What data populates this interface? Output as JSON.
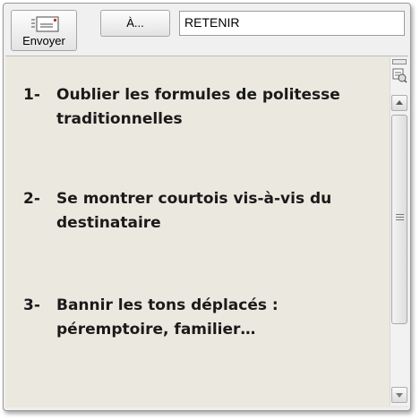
{
  "toolbar": {
    "send_label": "Envoyer",
    "send_icon": "send-envelope-icon",
    "to_label": "À...",
    "subject_value": "RETENIR"
  },
  "message": {
    "items": [
      {
        "num": "1-",
        "text": "Oublier les formules de politesse traditionnelles"
      },
      {
        "num": "2-",
        "text": "Se montrer courtois vis-à-vis du destinataire"
      },
      {
        "num": "3-",
        "text": "Bannir les tons déplacés : péremptoire, familier…"
      }
    ]
  },
  "scrollbar": {
    "icons": [
      "split-handle-icon",
      "zoom-icon",
      "up-arrow-icon",
      "grip-icon",
      "down-arrow-icon"
    ]
  },
  "colors": {
    "content_bg": "#ebe8df",
    "window_bg": "#f0f0f0"
  }
}
